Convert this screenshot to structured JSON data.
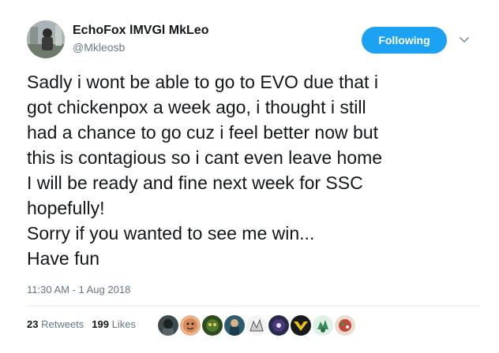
{
  "user": {
    "display_name": "EchoFox lMVGl MkLeo",
    "handle": "@Mkleosb"
  },
  "follow_button": {
    "label": "Following",
    "color": "#1da1f2"
  },
  "tweet": {
    "lines": [
      "Sadly i wont be able to go to EVO due that i",
      "got chickenpox a week ago, i thought i still",
      "had a chance to go cuz i feel better now but",
      "this is contagious so i cant even leave home",
      "I will be ready and fine next week for SSC",
      "hopefully!",
      "Sorry if you wanted to see me win...",
      "Have fun"
    ],
    "timestamp": "11:30 AM - 1 Aug 2018"
  },
  "stats": {
    "retweets_count": "23",
    "retweets_label": "Retweets",
    "likes_count": "199",
    "likes_label": "Likes"
  },
  "likers": [
    {
      "icon": "liker-avatar-1",
      "color": "#3c4a4e"
    },
    {
      "icon": "liker-avatar-2",
      "color": "#d98a5a"
    },
    {
      "icon": "liker-avatar-3",
      "color": "#4d7a2e"
    },
    {
      "icon": "liker-avatar-4",
      "color": "#2d5c6e"
    },
    {
      "icon": "liker-avatar-5",
      "color": "#cfcfcf"
    },
    {
      "icon": "liker-avatar-6",
      "color": "#2a2a4a"
    },
    {
      "icon": "liker-avatar-7",
      "color": "#e8c21a"
    },
    {
      "icon": "liker-avatar-8",
      "color": "#3a8a5a"
    },
    {
      "icon": "liker-avatar-9",
      "color": "#c04a3a"
    }
  ]
}
